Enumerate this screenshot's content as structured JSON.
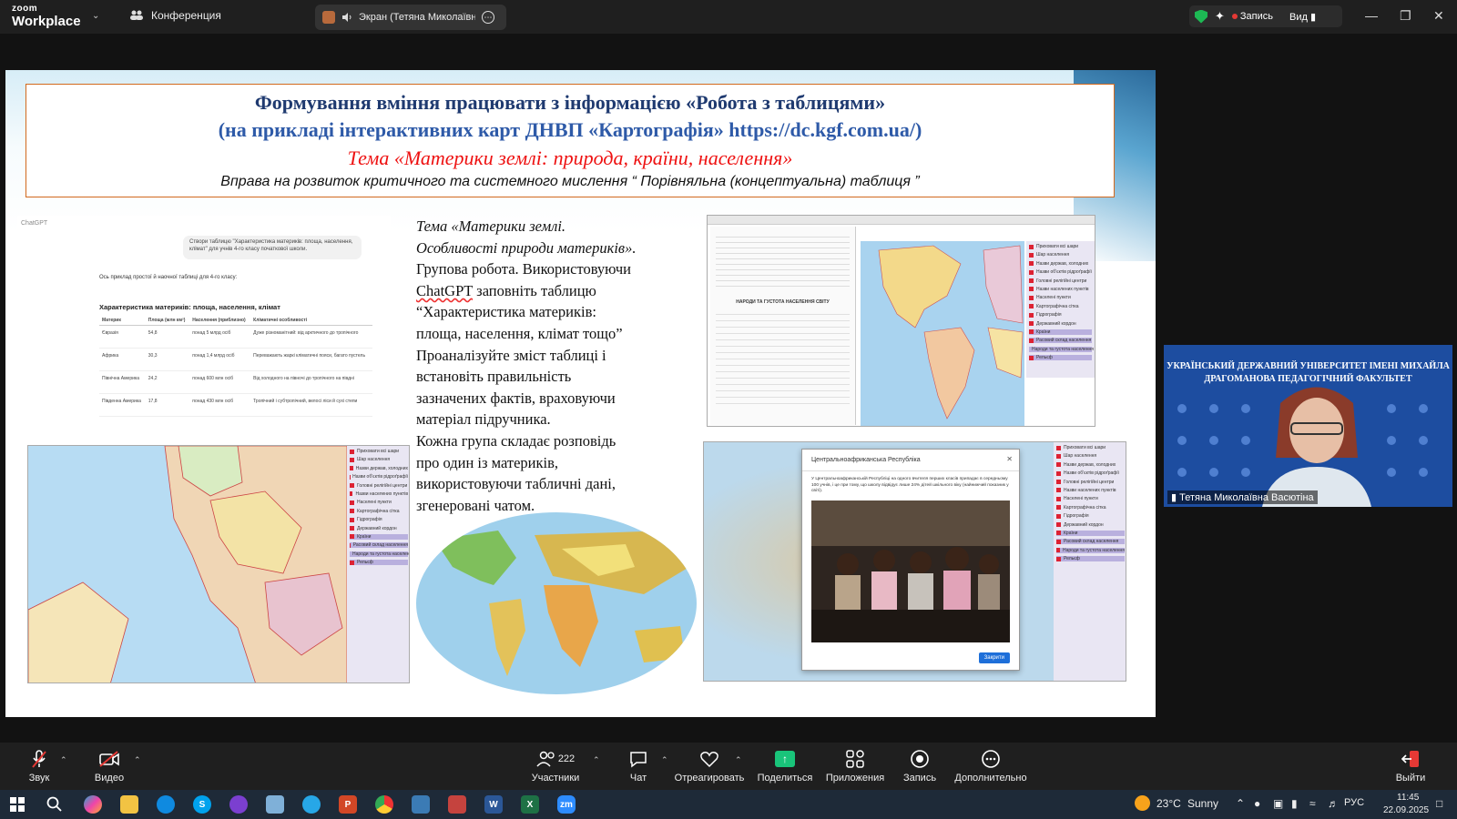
{
  "app": {
    "brand_small": "zoom",
    "brand_large": "Workplace"
  },
  "topbar": {
    "conference_label": "Конференция",
    "screen_tab_label": "Экран (Тетяна Миколаївна В",
    "record_label": "Запись",
    "view_label": "Вид"
  },
  "slide": {
    "title_line1": "Формування вміння працювати з інформацією «Робота з таблицями»",
    "title_line2": "(на прикладі інтерактивних карт ДНВП «Картографія» https://dc.kgf.com.ua/)",
    "title_line3": "Тема «Материки землі: природа, країни, населення»",
    "title_line4": "Вправа на розвиток критичного та системного мислення “ Порівняльна (концептуальна) таблиця ”",
    "chatgpt": {
      "label": "ChatGPT",
      "prompt": "Створи таблицю \"Характеристика материків: площа, населення, клімат\" для учнів 4-го класу початкової школи.",
      "intro": "Ось приклад простої й наочної таблиці для 4-го класу:",
      "table_title": "Характеристика материків: площа, населення, клімат",
      "headers": [
        "Материк",
        "Площа (млн км²)",
        "Населення (приблизно)",
        "Кліматичні особливості"
      ],
      "rows": [
        [
          "Євразія",
          "54,8",
          "понад 5 млрд осіб",
          "Дуже різноманітний: від арктичного до тропічного"
        ],
        [
          "Африка",
          "30,3",
          "понад 1,4 млрд осіб",
          "Переважають жаркі кліматичні пояси, багато пустель"
        ],
        [
          "Північна Америка",
          "24,2",
          "понад 600 млн осіб",
          "Від холодного на півночі до тропічного на півдні"
        ],
        [
          "Південна Америка",
          "17,8",
          "понад 430 млн осіб",
          "Тропічний і субтропічний, велосі ліси й сухі степи"
        ]
      ]
    },
    "text": {
      "line1": "Тема «Материки землі.",
      "line2": "Особливості природи материків».",
      "line3": "Групова робота. Використовуючи",
      "line4_pre": "",
      "line4_word": "ChatGPT",
      "line4_post": " заповніть таблицю",
      "line5": "“Характеристика материків:",
      "line6": "площа, населення, клімат тощо”",
      "line7": "Проаналізуйте зміст таблиці і",
      "line8": "встановіть правильність",
      "line9": "зазначених фактів, враховуючи",
      "line10": "матеріал підручника.",
      "line11": "Кожна група складає розповідь",
      "line12": "про один із материків,",
      "line13": "використовуючи табличні дані,",
      "line14": "згенеровані чатом."
    },
    "map_doc_title": "НАРОДИ ТА ГУСТОТА НАСЕЛЕННЯ СВІТУ",
    "legend": [
      "Приховати всі шари",
      "Шар населення",
      "Назви держав, холодних",
      "Назви об'єктів рідроґрафії",
      "Головні релігійні центри",
      "Назви населених пунктів",
      "Населені пункти",
      "Картографічна сітка",
      "Гідрографія",
      "Державний кордон",
      "Країни",
      "Расовий склад населення",
      "Народи та густота населення",
      "Рельєф"
    ],
    "dialog": {
      "title": "Центральноафриканська Республіка",
      "body": "У Центральноафриканській Республіці на одного вчителя перших класів припадає в середньому 100 учнів, і це при тому, що школу відвідує лише 24% дітей шкільного віку (найнижчий показник у світі).",
      "button": "Закрити"
    }
  },
  "video": {
    "banner": "УКРАЇНСЬКИЙ ДЕРЖАВНИЙ УНІВЕРСИТЕТ ІМЕНІ МИХАЙЛА ДРАГОМАНОВА ПЕДАГОГІЧНИЙ ФАКУЛЬТЕТ",
    "name": "Тетяна Миколаївна Васютіна"
  },
  "toolbar": {
    "audio": "Звук",
    "video": "Видео",
    "participants": "Участники",
    "participants_count": "222",
    "chat": "Чат",
    "react": "Отреагировать",
    "share": "Поделиться",
    "apps": "Приложения",
    "record": "Запись",
    "more": "Дополнительно",
    "leave": "Выйти"
  },
  "taskbar": {
    "weather_temp": "23°C",
    "weather_text": "Sunny",
    "lang": "РУС",
    "time": "11:45",
    "date": "22.09.2025"
  },
  "colors": {
    "accent_green": "#19c47a",
    "record_red": "#e53935",
    "title_red": "#e11111",
    "title_blue": "#2e5aa8"
  }
}
